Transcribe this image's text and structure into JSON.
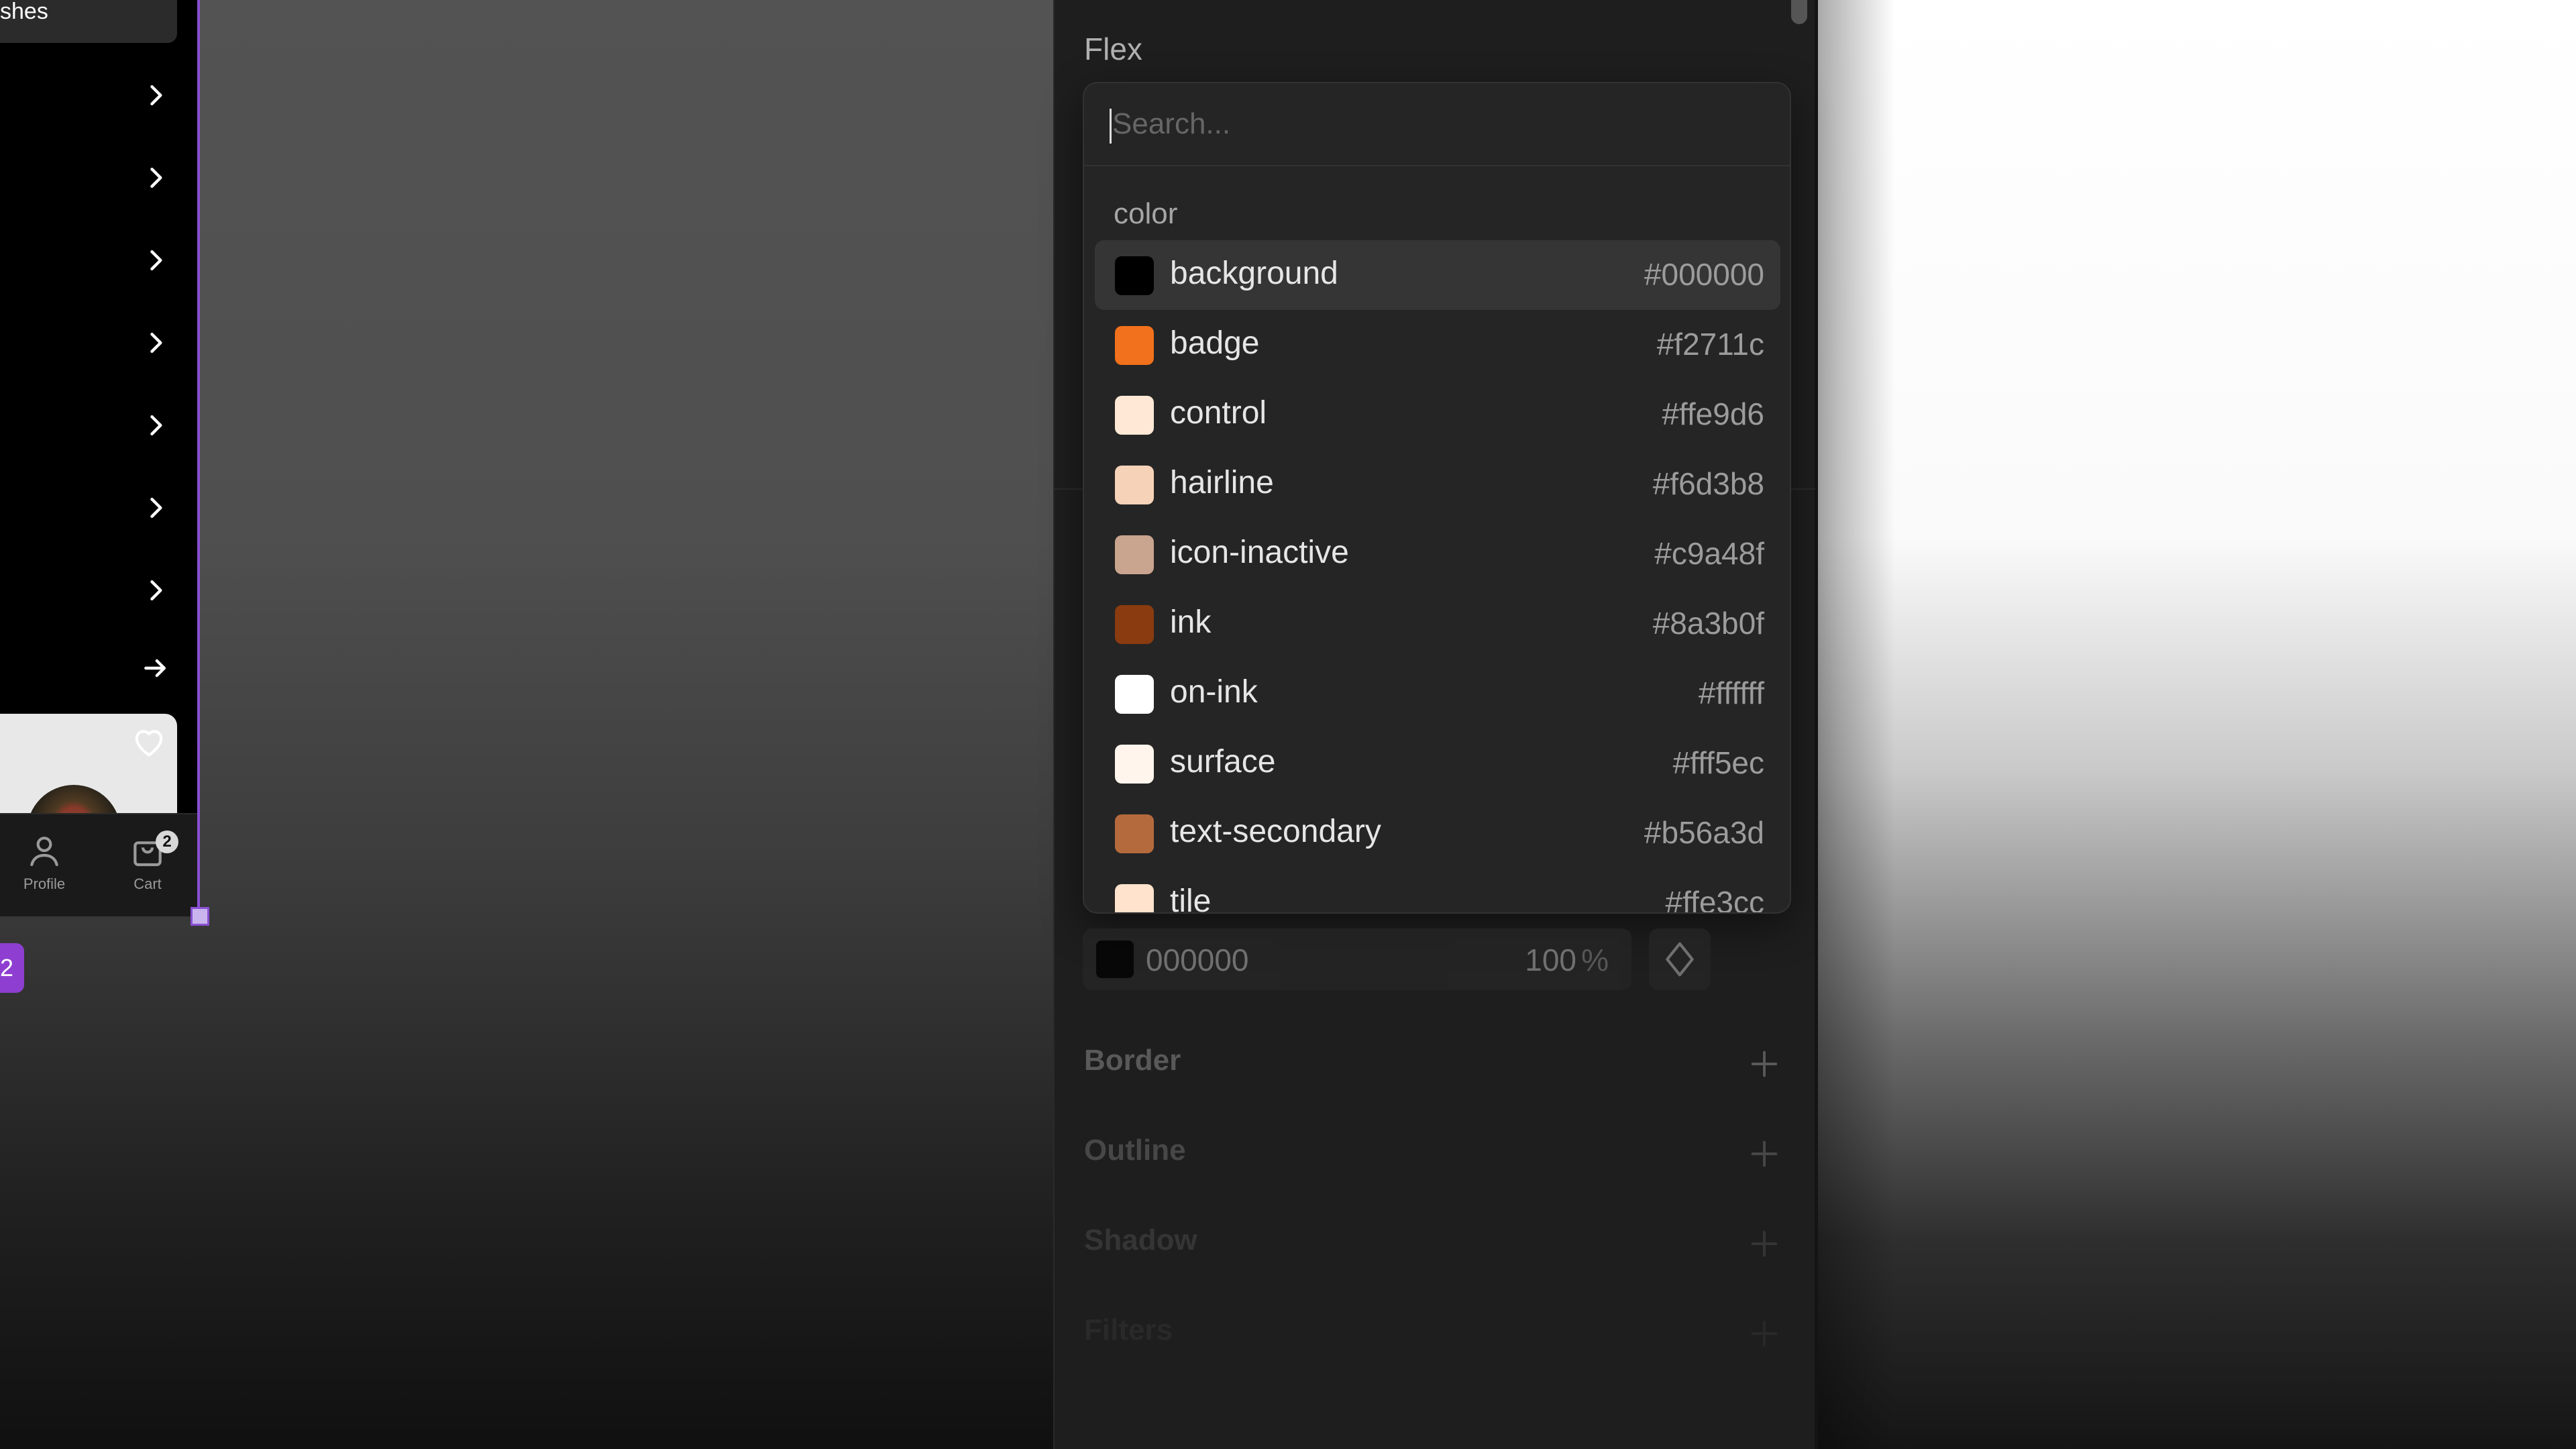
{
  "phone": {
    "top_label": "shes",
    "tabs": [
      {
        "label": "Profile",
        "icon": "person-icon"
      },
      {
        "label": "Cart",
        "icon": "bag-icon",
        "badge": "2"
      }
    ],
    "frame_tag": "2"
  },
  "inspector": {
    "section_title": "Flex",
    "search": {
      "placeholder": "Search...",
      "value": ""
    },
    "group_label": "color",
    "colors": [
      {
        "name": "background",
        "hex": "#000000"
      },
      {
        "name": "badge",
        "hex": "#f2711c"
      },
      {
        "name": "control",
        "hex": "#ffe9d6"
      },
      {
        "name": "hairline",
        "hex": "#f6d3b8"
      },
      {
        "name": "icon-inactive",
        "hex": "#c9a48f"
      },
      {
        "name": "ink",
        "hex": "#8a3b0f"
      },
      {
        "name": "on-ink",
        "hex": "#ffffff"
      },
      {
        "name": "surface",
        "hex": "#fff5ec"
      },
      {
        "name": "text-secondary",
        "hex": "#b56a3d"
      },
      {
        "name": "tile",
        "hex": "#ffe3cc"
      }
    ],
    "fill": {
      "hex": "000000",
      "opacity": "100",
      "unit": "%"
    },
    "sections": [
      {
        "title": "Border"
      },
      {
        "title": "Outline"
      },
      {
        "title": "Shadow"
      },
      {
        "title": "Filters"
      }
    ]
  }
}
